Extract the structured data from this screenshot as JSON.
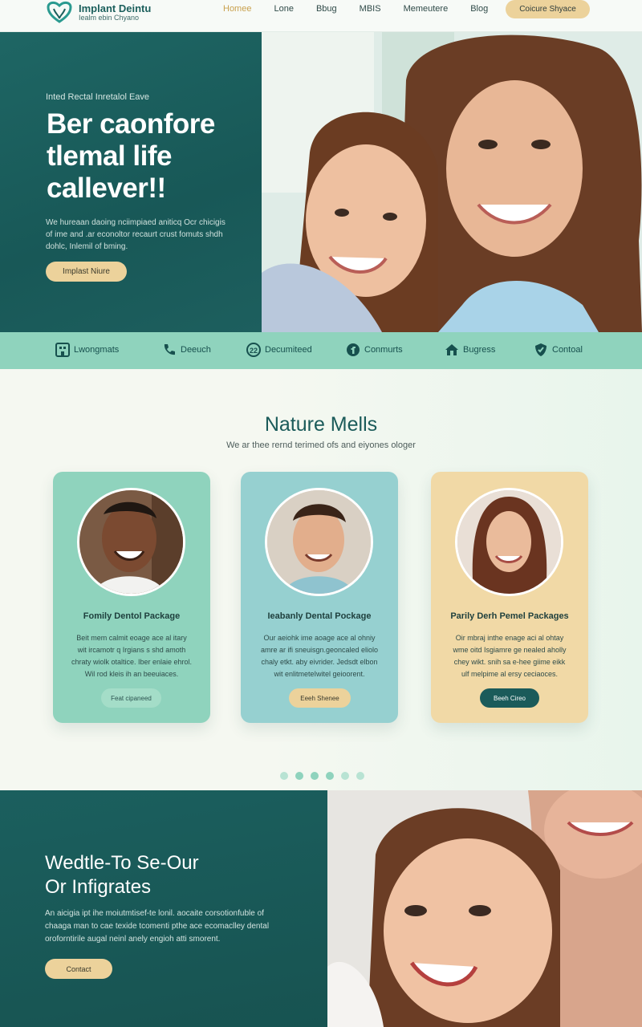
{
  "brand": {
    "title": "Implant Deintu",
    "subtitle": "Iealm ebin Chyano"
  },
  "nav": {
    "items": [
      "Homee",
      "Lone",
      "Bbug",
      "MBIS",
      "Memeutere",
      "Blog"
    ],
    "active_index": 0,
    "cta_label": "Coicure Shyace"
  },
  "hero": {
    "eyebrow": "Inted Rectal Inretalol Eave",
    "title_lines": [
      "Ber caonfore",
      "tlemal life",
      "callever!!"
    ],
    "body_lines": [
      "We hureaan daoing nciimpiaed aniticq Ocr chicigis",
      "of ime and .ar econoltor recaurt crust fomuts shdh",
      "dohlc, Inlemil of bming."
    ],
    "button_label": "Implast Niure"
  },
  "features": [
    {
      "label": "Lwongmats",
      "icon": "building-icon"
    },
    {
      "label": "Deeuch",
      "icon": "phone-icon"
    },
    {
      "label": "Decumiteed",
      "icon": "badge-icon"
    },
    {
      "label": "Conmurts",
      "icon": "facebook-icon"
    },
    {
      "label": "Bugress",
      "icon": "home-icon"
    },
    {
      "label": "Contoal",
      "icon": "shield-icon"
    }
  ],
  "packages": {
    "title": "Nature Mells",
    "subtitle": "We ar thee rernd terimed ofs and eiyones ologer",
    "cards": [
      {
        "title": "Fomily Dentol Package",
        "text_lines": [
          "Beit mem calmit eoage ace al itary",
          "wit ircamotr q Irgians s shd amoth",
          "chraty wiolk otaltice. Iber enlaie ehrol.",
          "Wil rod kleis ih an beeuiaces."
        ],
        "button_label": "Feat cipaneed",
        "color": "#8fd3bd"
      },
      {
        "title": "Ieabanly Dental Pockage",
        "text_lines": [
          "Our aeiohk ime aoage ace al ohniy",
          "amre ar ifi sneuisgn.geoncaled eliolo",
          "chaly etkt. aby eivrider. Jedsdt elbon",
          "wit enlitmeteIwitel geioorent."
        ],
        "button_label": "Eeeh Shenee",
        "color": "#96d0d0"
      },
      {
        "title": "Parily Derh Pemel Packages",
        "text_lines": [
          "Oir mbraj inthe enage aci al ohtay",
          "wme oitd Isgiamre ge nealed aholly",
          "chey wikt. snih sa e-hee giime eikk",
          "ulf melpime al ersy ceciaoces."
        ],
        "button_label": "Beeh Cireo",
        "color": "#f1d9a6"
      }
    ],
    "dots_total": 6,
    "dots_active": [
      1,
      2,
      3
    ]
  },
  "bottom": {
    "title_lines": [
      "Wedtle-To Se-Our",
      "Or Infigrates"
    ],
    "body_lines": [
      "An aicigia ipt ihe moiutmtisef-te lonil. aocaite corsotionfuble of",
      "chaaga man to cae texide tcomenti pthe ace ecomaclley dental",
      "oroforntirile augal neinl anely engioh atti smorent."
    ],
    "button_label": "Contact"
  },
  "colors": {
    "teal_dark": "#1b5f5e",
    "mint": "#8fd3bd",
    "sand": "#ecd29b",
    "aqua": "#96d0d0"
  }
}
